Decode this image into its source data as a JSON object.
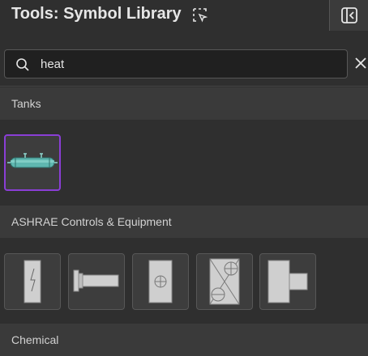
{
  "header": {
    "title": "Tools: Symbol Library",
    "title_icon": "selection-cursor-icon",
    "collapse_icon": "panel-collapse-icon"
  },
  "search": {
    "value": "heat",
    "placeholder": "",
    "search_icon": "search-icon",
    "clear_icon": "close-icon"
  },
  "sections": [
    {
      "label": "Tanks",
      "items": [
        {
          "symbol": "heat-exchanger-tank",
          "selected": true
        }
      ]
    },
    {
      "label": "ASHRAE Controls & Equipment",
      "items": [
        {
          "symbol": "electric-heater-element",
          "selected": false
        },
        {
          "symbol": "duct-heater",
          "selected": false
        },
        {
          "symbol": "heating-coil-panel",
          "selected": false
        },
        {
          "symbol": "dual-fan-coil",
          "selected": false
        },
        {
          "symbol": "unit-heater",
          "selected": false
        }
      ]
    },
    {
      "label": "Chemical",
      "items": []
    }
  ],
  "colors": {
    "background": "#2f2f2f",
    "section_header": "#3a3a3a",
    "selected_border": "#8a3ed6",
    "tank_fill": "#5fb7b0"
  }
}
